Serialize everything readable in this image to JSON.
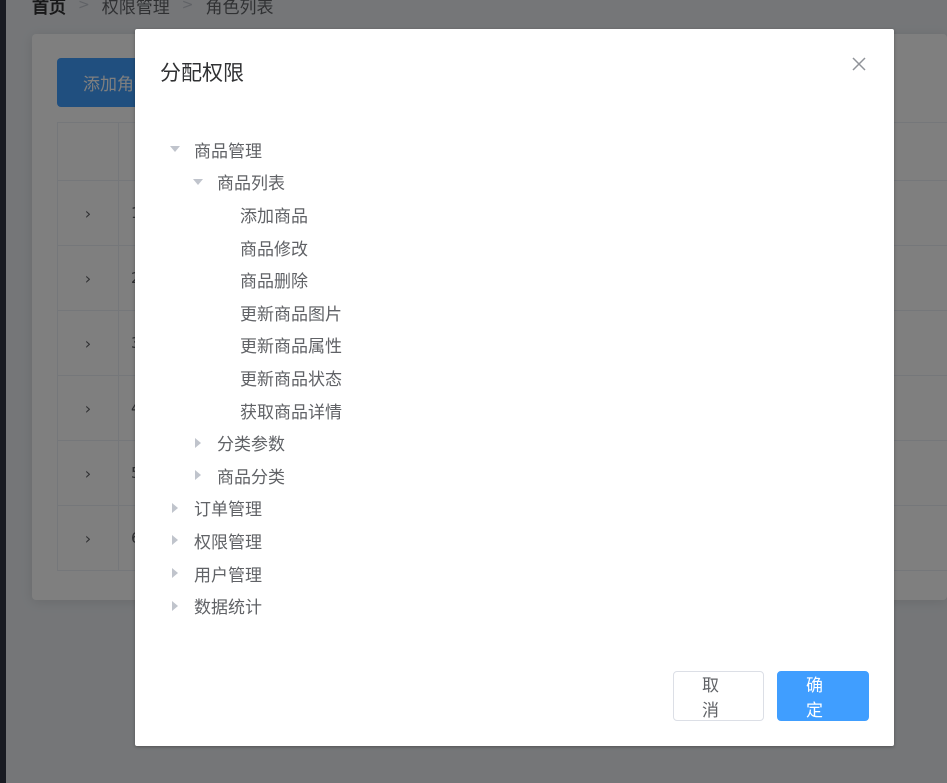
{
  "breadcrumb": {
    "home": "首页",
    "level1": "权限管理",
    "level2": "角色列表"
  },
  "page": {
    "add_role_label": "添加角色",
    "rows": [
      "1",
      "2",
      "3",
      "4",
      "5",
      "6"
    ]
  },
  "dialog": {
    "title": "分配权限",
    "tree": [
      {
        "label": "商品管理",
        "level": 0,
        "state": "expanded"
      },
      {
        "label": "商品列表",
        "level": 1,
        "state": "expanded"
      },
      {
        "label": "添加商品",
        "level": 2,
        "state": "leaf"
      },
      {
        "label": "商品修改",
        "level": 2,
        "state": "leaf"
      },
      {
        "label": "商品删除",
        "level": 2,
        "state": "leaf"
      },
      {
        "label": "更新商品图片",
        "level": 2,
        "state": "leaf"
      },
      {
        "label": "更新商品属性",
        "level": 2,
        "state": "leaf"
      },
      {
        "label": "更新商品状态",
        "level": 2,
        "state": "leaf"
      },
      {
        "label": "获取商品详情",
        "level": 2,
        "state": "leaf"
      },
      {
        "label": "分类参数",
        "level": 1,
        "state": "collapsed"
      },
      {
        "label": "商品分类",
        "level": 1,
        "state": "collapsed"
      },
      {
        "label": "订单管理",
        "level": 0,
        "state": "collapsed"
      },
      {
        "label": "权限管理",
        "level": 0,
        "state": "collapsed"
      },
      {
        "label": "用户管理",
        "level": 0,
        "state": "collapsed"
      },
      {
        "label": "数据统计",
        "level": 0,
        "state": "collapsed"
      }
    ],
    "cancel_label": "取消",
    "confirm_label": "确定",
    "close_icon": "close-icon"
  },
  "colors": {
    "primary": "#409eff",
    "overlay": "rgba(0,0,0,0.5)"
  }
}
